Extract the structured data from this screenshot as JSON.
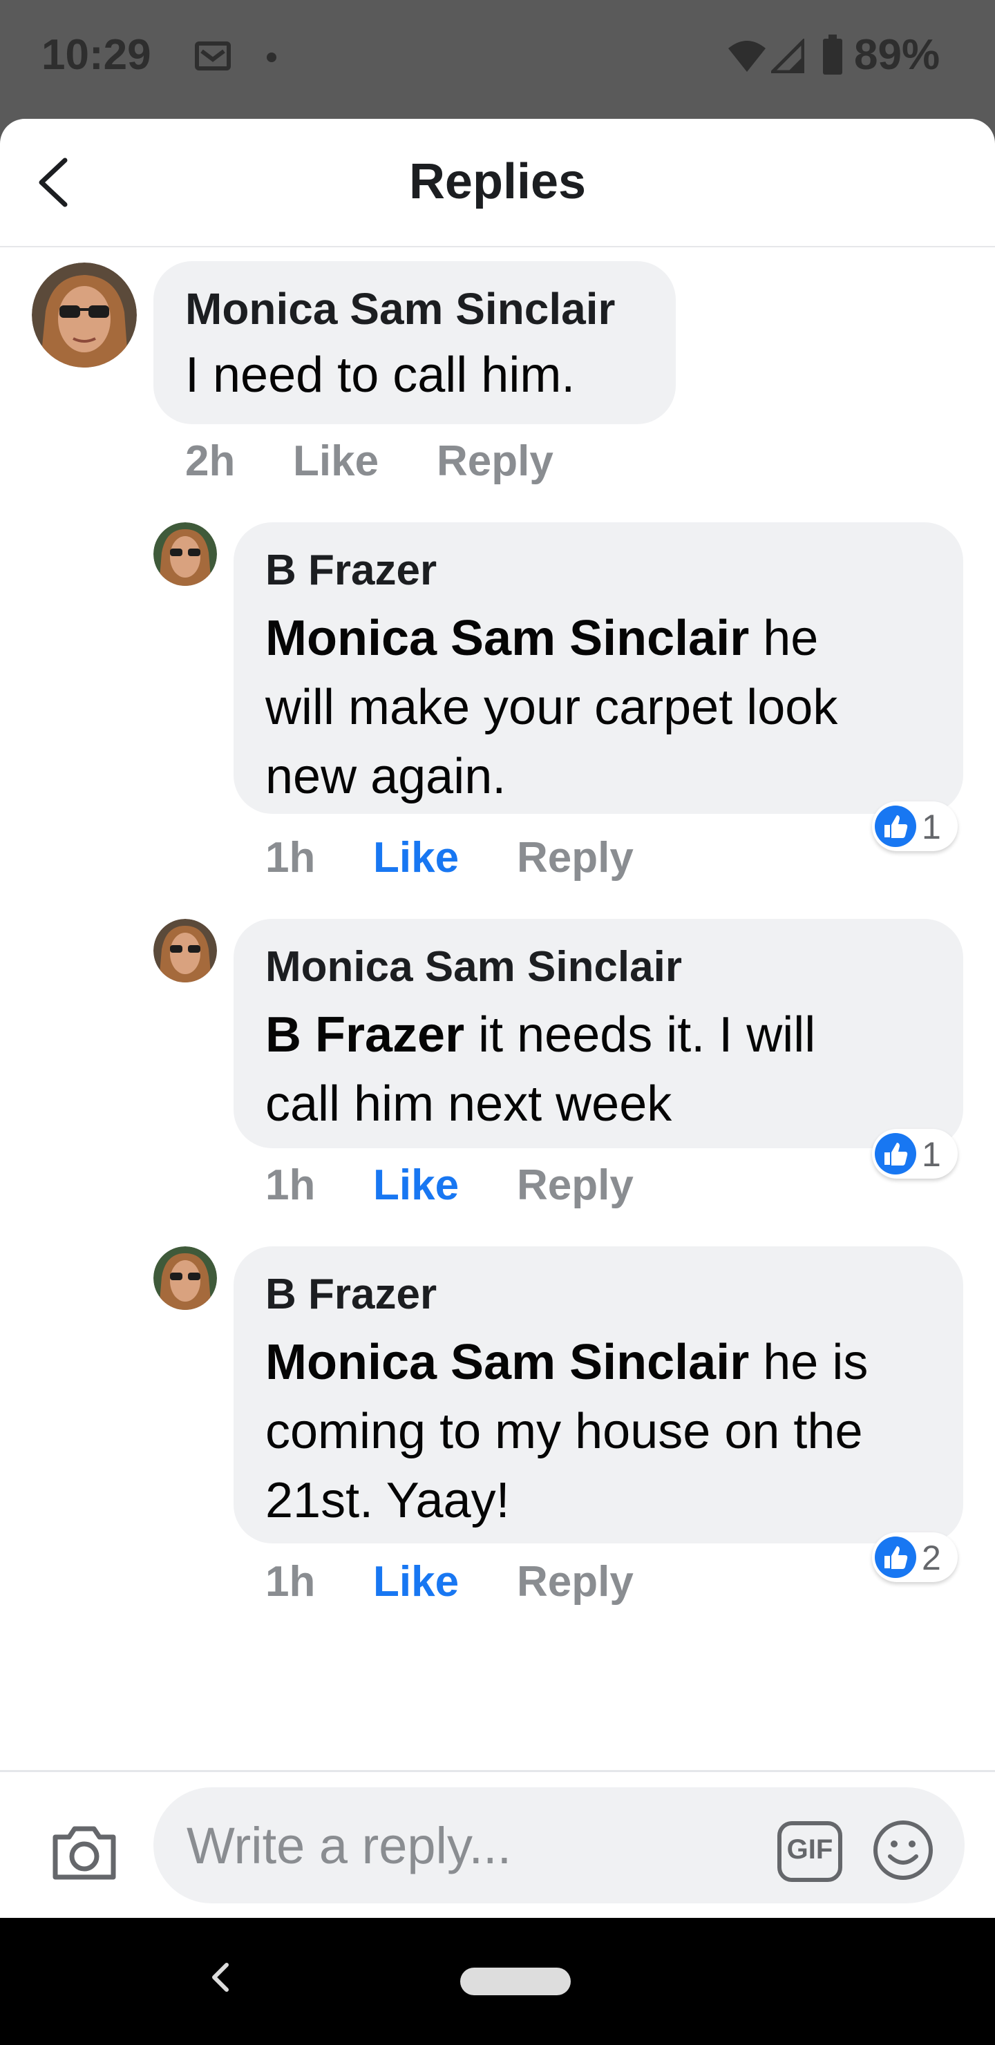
{
  "status_bar": {
    "time": "10:29",
    "battery": "89%",
    "icons": [
      "mail-icon",
      "notification-dot",
      "wifi-icon",
      "signal-icon",
      "battery-icon"
    ]
  },
  "header": {
    "title": "Replies",
    "back_icon": "chevron-left-icon"
  },
  "comments": [
    {
      "author": "Monica Sam Sinclair",
      "mention": "",
      "text": "I need to call him.",
      "time": "2h",
      "like_label": "Like",
      "reply_label": "Reply",
      "liked": false,
      "reactions": ""
    },
    {
      "author": "B Frazer",
      "mention": "Monica Sam Sinclair",
      "text_line1": " he",
      "text_line2": "will make your carpet look",
      "text_line3": "new again.",
      "time": "1h",
      "like_label": "Like",
      "reply_label": "Reply",
      "liked": true,
      "reactions": "1"
    },
    {
      "author": "Monica Sam Sinclair",
      "mention": "B Frazer",
      "text_line1": " it needs it. I will",
      "text_line2": "call him next week",
      "time": "1h",
      "like_label": "Like",
      "reply_label": "Reply",
      "liked": true,
      "reactions": "1"
    },
    {
      "author": "B Frazer",
      "mention": "Monica Sam Sinclair",
      "text_line1": " he is",
      "text_line2": "coming to my house on the",
      "text_line3": "21st. Yaay!",
      "time": "1h",
      "like_label": "Like",
      "reply_label": "Reply",
      "liked": true,
      "reactions": "2"
    }
  ],
  "composer": {
    "placeholder": "Write a reply...",
    "camera_icon": "camera-icon",
    "gif_label": "GIF",
    "emoji_icon": "smiley-icon"
  },
  "colors": {
    "accent": "#1877f2",
    "bubble": "#f0f1f3",
    "meta_gray": "#8a8d91",
    "status_bar": "#5a5a5a"
  }
}
